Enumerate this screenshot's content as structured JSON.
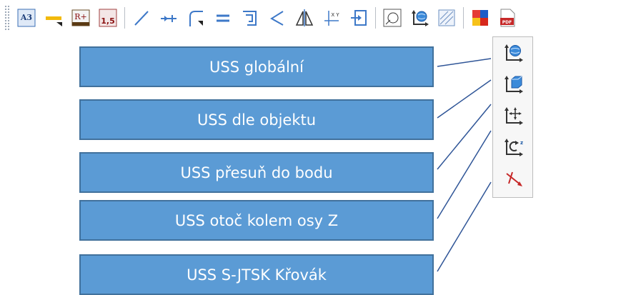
{
  "toolbar": {
    "buttons": [
      {
        "icon": "a3-format-icon",
        "text": "A3"
      },
      {
        "icon": "dimension-line-icon",
        "text": ""
      },
      {
        "icon": "r-plus-icon",
        "text": "R+"
      },
      {
        "icon": "scale-1-5-icon",
        "text": "1,5"
      },
      {
        "icon": "line-icon",
        "text": ""
      },
      {
        "icon": "extend-line-icon",
        "text": ""
      },
      {
        "icon": "fillet-icon",
        "text": ""
      },
      {
        "icon": "parallel-icon",
        "text": ""
      },
      {
        "icon": "offset-icon",
        "text": ""
      },
      {
        "icon": "angle-icon",
        "text": ""
      },
      {
        "icon": "mirror-icon",
        "text": ""
      },
      {
        "icon": "xy-coordinates-icon",
        "text": "X Y"
      },
      {
        "icon": "insert-icon",
        "text": ""
      },
      {
        "icon": "view-ucs-icon",
        "text": ""
      },
      {
        "icon": "ucs-globe-icon",
        "text": ""
      },
      {
        "icon": "hatch-icon",
        "text": ""
      },
      {
        "icon": "color-palette-icon",
        "text": ""
      },
      {
        "icon": "pdf-export-icon",
        "text": "PDF"
      }
    ]
  },
  "dropdown": {
    "items": [
      {
        "icon": "ucs-global-icon"
      },
      {
        "icon": "ucs-object-icon"
      },
      {
        "icon": "ucs-move-icon"
      },
      {
        "icon": "ucs-rotate-z-icon"
      },
      {
        "icon": "ucs-sjtsk-icon"
      }
    ]
  },
  "callouts": [
    {
      "label": "USS globální"
    },
    {
      "label": "USS dle objektu"
    },
    {
      "label": "USS přesuň do bodu"
    },
    {
      "label": "USS otoč kolem osy Z"
    },
    {
      "label": "USS S-JTSK Křovák"
    }
  ],
  "colors": {
    "callout_fill": "#5b9bd5",
    "callout_border": "#41719c",
    "callout_text": "#ffffff",
    "leader_line": "#2f5597"
  }
}
